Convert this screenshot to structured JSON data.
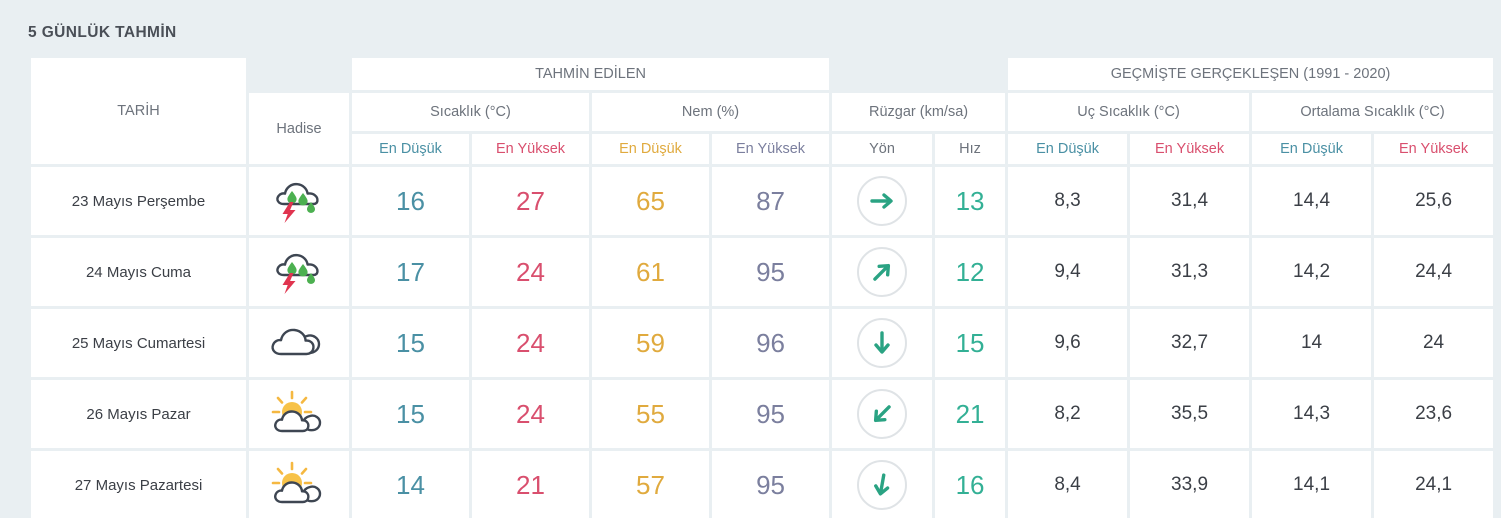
{
  "page": {
    "title": "5 GÜNLÜK TAHMİN"
  },
  "colors": {
    "background": "#e9eff2",
    "cell": "#ffffff",
    "temp_low": "#4a90a4",
    "temp_high": "#d94f6e",
    "humidity_low": "#e0aa3e",
    "humidity_high": "#7b7f9e",
    "wind_speed": "#33b095",
    "text": "#3b3f46",
    "muted": "#6d737c"
  },
  "header": {
    "tarih": "TARİH",
    "hadise": "Hadise",
    "group_forecast": "TAHMİN EDİLEN",
    "group_history": "GEÇMİŞTE GERÇEKLEŞEN (1991 - 2020)",
    "sub_groups": {
      "sicaklik": "Sıcaklık (°C)",
      "nem": "Nem (%)",
      "ruzgar": "Rüzgar (km/sa)",
      "uc_sicaklik": "Uç Sıcaklık (°C)",
      "ortalama_sicaklik": "Ortalama Sıcaklık (°C)"
    },
    "columns": {
      "temp_min": "En Düşük",
      "temp_max": "En Yüksek",
      "hum_min": "En Düşük",
      "hum_max": "En Yüksek",
      "wind_dir": "Yön",
      "wind_speed": "Hız",
      "hist_extreme_min": "En Düşük",
      "hist_extreme_max": "En Yüksek",
      "hist_mean_min": "En Düşük",
      "hist_mean_max": "En Yüksek"
    }
  },
  "rows": [
    {
      "date": "23 Mayıs Perşembe",
      "icon": "thunderstorm-rain-icon",
      "temp_min": "16",
      "temp_max": "27",
      "hum_min": "65",
      "hum_max": "87",
      "wind_dir_icon": "arrow-east-icon",
      "wind_dir_deg": 0,
      "wind_speed": "13",
      "hist_extreme_min": "8,3",
      "hist_extreme_max": "31,4",
      "hist_mean_min": "14,4",
      "hist_mean_max": "25,6"
    },
    {
      "date": "24 Mayıs Cuma",
      "icon": "thunderstorm-rain-icon",
      "temp_min": "17",
      "temp_max": "24",
      "hum_min": "61",
      "hum_max": "95",
      "wind_dir_icon": "arrow-northeast-icon",
      "wind_dir_deg": -45,
      "wind_speed": "12",
      "hist_extreme_min": "9,4",
      "hist_extreme_max": "31,3",
      "hist_mean_min": "14,2",
      "hist_mean_max": "24,4"
    },
    {
      "date": "25 Mayıs Cumartesi",
      "icon": "cloudy-icon",
      "temp_min": "15",
      "temp_max": "24",
      "hum_min": "59",
      "hum_max": "96",
      "wind_dir_icon": "arrow-south-icon",
      "wind_dir_deg": 90,
      "wind_speed": "15",
      "hist_extreme_min": "9,6",
      "hist_extreme_max": "32,7",
      "hist_mean_min": "14",
      "hist_mean_max": "24"
    },
    {
      "date": "26 Mayıs Pazar",
      "icon": "partly-sunny-icon",
      "temp_min": "15",
      "temp_max": "24",
      "hum_min": "55",
      "hum_max": "95",
      "wind_dir_icon": "arrow-southwest-icon",
      "wind_dir_deg": 135,
      "wind_speed": "21",
      "hist_extreme_min": "8,2",
      "hist_extreme_max": "35,5",
      "hist_mean_min": "14,3",
      "hist_mean_max": "23,6"
    },
    {
      "date": "27 Mayıs Pazartesi",
      "icon": "partly-sunny-icon",
      "temp_min": "14",
      "temp_max": "21",
      "hum_min": "57",
      "hum_max": "95",
      "wind_dir_icon": "arrow-south-icon",
      "wind_dir_deg": 100,
      "wind_speed": "16",
      "hist_extreme_min": "8,4",
      "hist_extreme_max": "33,9",
      "hist_mean_min": "14,1",
      "hist_mean_max": "24,1"
    }
  ]
}
